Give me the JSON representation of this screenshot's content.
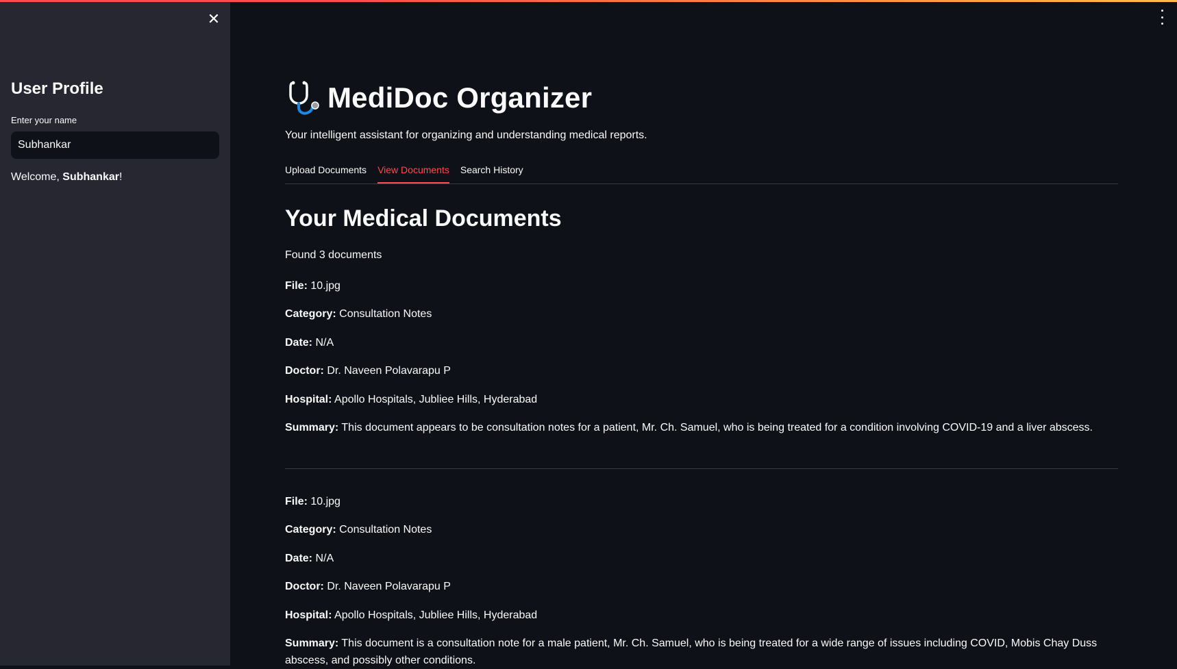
{
  "sidebar": {
    "close_icon": "close-icon",
    "title": "User Profile",
    "name_label": "Enter your name",
    "name_value": "Subhankar",
    "welcome_prefix": "Welcome, ",
    "welcome_name": "Subhankar",
    "welcome_suffix": "!"
  },
  "header": {
    "menu_icon": "kebab-menu-icon",
    "app_icon": "stethoscope-icon",
    "title": "MediDoc Organizer",
    "subtitle": "Your intelligent assistant for organizing and understanding medical reports."
  },
  "tabs": [
    {
      "label": "Upload Documents",
      "active": false
    },
    {
      "label": "View Documents",
      "active": true
    },
    {
      "label": "Search History",
      "active": false
    }
  ],
  "main": {
    "section_title": "Your Medical Documents",
    "found_text": "Found 3 documents"
  },
  "documents": [
    {
      "file_label": "File:",
      "file": "10.jpg",
      "category_label": "Category:",
      "category": "Consultation Notes",
      "date_label": "Date:",
      "date": "N/A",
      "doctor_label": "Doctor:",
      "doctor": "Dr. Naveen Polavarapu P",
      "hospital_label": "Hospital:",
      "hospital": "Apollo Hospitals, Jubliee Hills, Hyderabad",
      "summary_label": "Summary:",
      "summary": "This document appears to be consultation notes for a patient, Mr. Ch. Samuel, who is being treated for a condition involving COVID-19 and a liver abscess."
    },
    {
      "file_label": "File:",
      "file": "10.jpg",
      "category_label": "Category:",
      "category": "Consultation Notes",
      "date_label": "Date:",
      "date": "N/A",
      "doctor_label": "Doctor:",
      "doctor": "Dr. Naveen Polavarapu P",
      "hospital_label": "Hospital:",
      "hospital": "Apollo Hospitals, Jubliee Hills, Hyderabad",
      "summary_label": "Summary:",
      "summary": "This document is a consultation note for a male patient, Mr. Ch. Samuel, who is being treated for a wide range of issues including COVID, Mobis Chay Duss abscess, and possibly other conditions."
    }
  ],
  "colors": {
    "background": "#0e1117",
    "sidebar": "#262730",
    "accent": "#ff4b4b",
    "text": "#fafafa"
  }
}
